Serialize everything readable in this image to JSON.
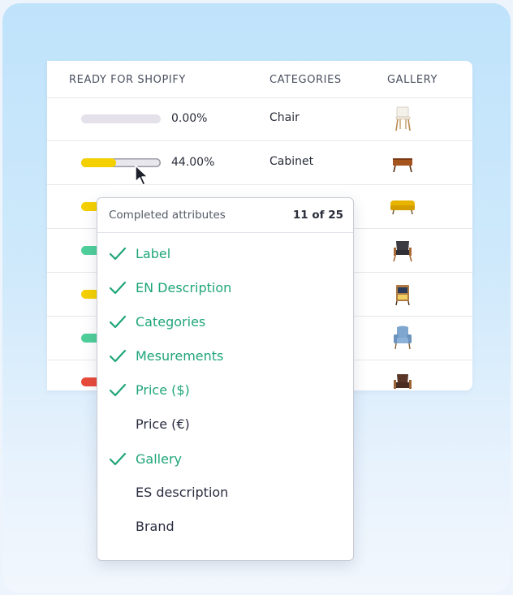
{
  "table": {
    "headers": {
      "ready": "READY FOR SHOPIFY",
      "categories": "CATEGORIES",
      "gallery": "GALLERY"
    },
    "rows": [
      {
        "progress_label": "0.00%",
        "progress_value": 0.0,
        "bar_color": "#e4e1ea",
        "category": "Chair",
        "thumb": "chair-icon"
      },
      {
        "progress_label": "44.00%",
        "progress_value": 0.44,
        "bar_color": "#f5d000",
        "category": "Cabinet",
        "thumb": "cabinet-icon"
      },
      {
        "bar_color": "#f5d000",
        "thumb": "sofa-icon"
      },
      {
        "bar_color": "#4fcf9a",
        "thumb": "armchair-icon"
      },
      {
        "bar_color": "#f5d000",
        "thumb": "side-table-icon"
      },
      {
        "bar_color": "#4fcf9a",
        "thumb": "blue-armchair-icon"
      },
      {
        "bar_color": "#e84a3a",
        "thumb": "wood-armchair-icon"
      }
    ]
  },
  "popover": {
    "title": "Completed attributes",
    "count": "11 of 25",
    "items": [
      {
        "label": "Label",
        "done": true
      },
      {
        "label": "EN Description",
        "done": true
      },
      {
        "label": "Categories",
        "done": true
      },
      {
        "label": "Mesurements",
        "done": true
      },
      {
        "label": "Price ($)",
        "done": true
      },
      {
        "label": "Price (€)",
        "done": false
      },
      {
        "label": "Gallery",
        "done": true
      },
      {
        "label": "ES description",
        "done": false
      },
      {
        "label": "Brand",
        "done": false
      }
    ]
  },
  "colors": {
    "check_green": "#1fa57a",
    "yellow": "#f5d000",
    "green": "#4fcf9a",
    "red": "#e84a3a"
  }
}
